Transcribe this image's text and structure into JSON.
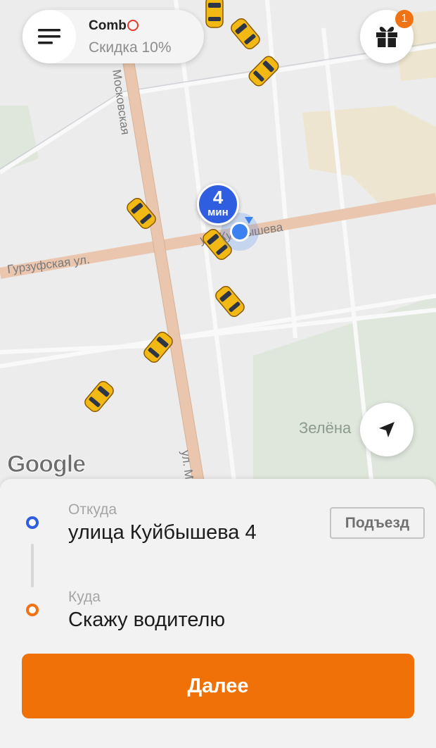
{
  "header": {
    "promo_brand": "Comb",
    "promo_text": "Скидка 10%"
  },
  "gift": {
    "badge_count": "1"
  },
  "map": {
    "eta_number": "4",
    "eta_unit": "мин",
    "street_moskovskaya": "Московская",
    "street_gurzufskaya": "Гурзуфская ул.",
    "street_kuybysheva": "ул. Куйбышева",
    "street_m": "ул. М",
    "park_label": "Зелёна",
    "provider_logo": "Google"
  },
  "route": {
    "from_label": "Откуда",
    "from_value": "улица Куйбышева 4",
    "entrance_label": "Подъезд",
    "to_label": "Куда",
    "to_value": "Скажу водителю"
  },
  "actions": {
    "next_label": "Далее"
  },
  "colors": {
    "accent": "#ef7107",
    "eta_blue": "#2f5fe0",
    "taxi_yellow": "#f2b814",
    "road": "#e9c6ad",
    "park": "#dfe6dc"
  }
}
